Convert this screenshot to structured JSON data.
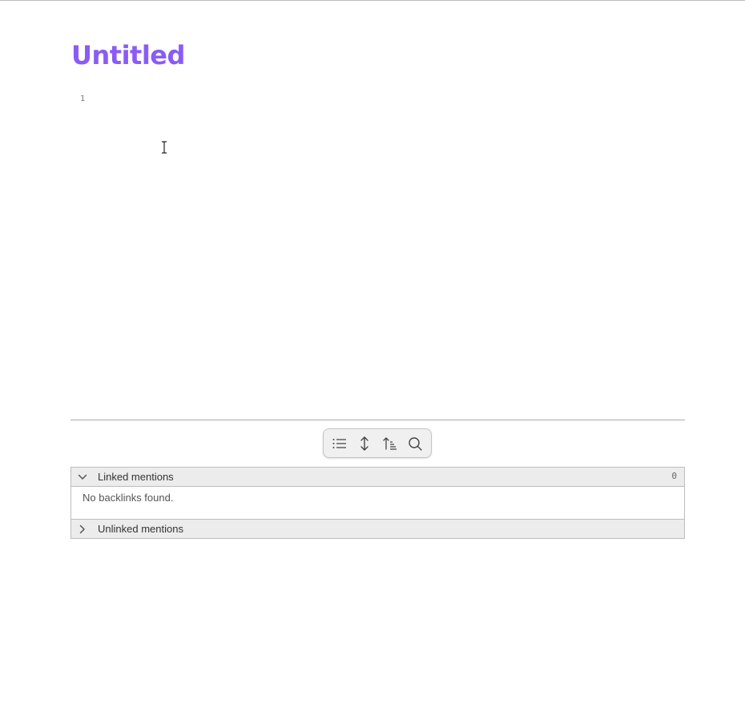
{
  "note": {
    "title": "Untitled",
    "title_color": "#8a5cf5",
    "line_numbers": [
      "1"
    ]
  },
  "toolbar": {
    "buttons": [
      {
        "name": "list-icon",
        "label": "Show as list"
      },
      {
        "name": "expand-icon",
        "label": "Expand"
      },
      {
        "name": "sort-icon",
        "label": "Sort"
      },
      {
        "name": "search-icon",
        "label": "Search"
      }
    ]
  },
  "backlinks": {
    "linked": {
      "label": "Linked mentions",
      "count": "0",
      "empty_message": "No backlinks found.",
      "expanded": true
    },
    "unlinked": {
      "label": "Unlinked mentions",
      "expanded": false
    }
  }
}
